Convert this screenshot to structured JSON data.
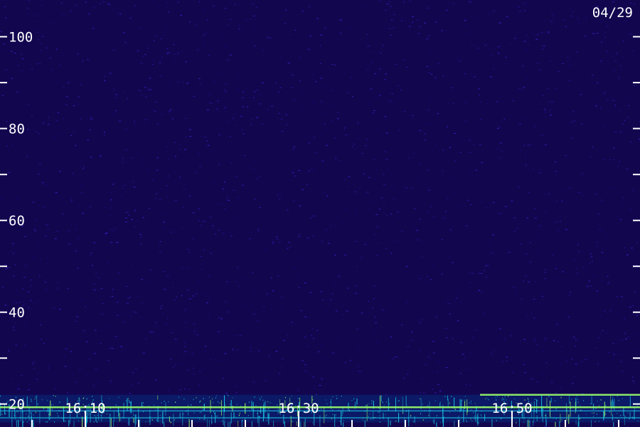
{
  "date_label": "04/29",
  "colors": {
    "background_low": "#1a0a6e",
    "background_mid": "#3a20c8",
    "signal": "#19c8e6",
    "signal_bright": "#9aff6a",
    "tick": "#ffffff",
    "label": "#ffffff"
  },
  "chart_data": {
    "type": "heatmap",
    "title": "",
    "xlabel": "",
    "ylabel": "",
    "x_tick_labels": [
      "16:10",
      "16:30",
      "16:50"
    ],
    "x_major_ticks": [
      "16:10",
      "16:30",
      "16:50"
    ],
    "x_minor_ticks": [
      "16:05",
      "16:15",
      "16:20",
      "16:25",
      "16:35",
      "16:40",
      "16:45",
      "16:55",
      "17:00"
    ],
    "y_tick_labels": [
      "20",
      "40",
      "60",
      "80",
      "100"
    ],
    "y_minor_ticks": [
      30,
      50,
      70,
      90
    ],
    "ylim": [
      15,
      108
    ],
    "xlim": [
      "16:02",
      "17:02"
    ],
    "grid": false,
    "noise_floor": "low intensity across all frequencies",
    "bright_band": [
      16,
      22
    ],
    "bright_lines": [
      {
        "y": 22.0,
        "x_start": "16:47",
        "x_end": "17:02",
        "intensity": "high"
      },
      {
        "y": 19.3,
        "x_start": "16:02",
        "x_end": "17:02",
        "intensity": "high"
      },
      {
        "y": 18.5,
        "x_start": "16:02",
        "x_end": "17:02",
        "intensity": "medium"
      },
      {
        "y": 17.0,
        "x_start": "16:02",
        "x_end": "17:02",
        "intensity": "medium"
      }
    ]
  }
}
